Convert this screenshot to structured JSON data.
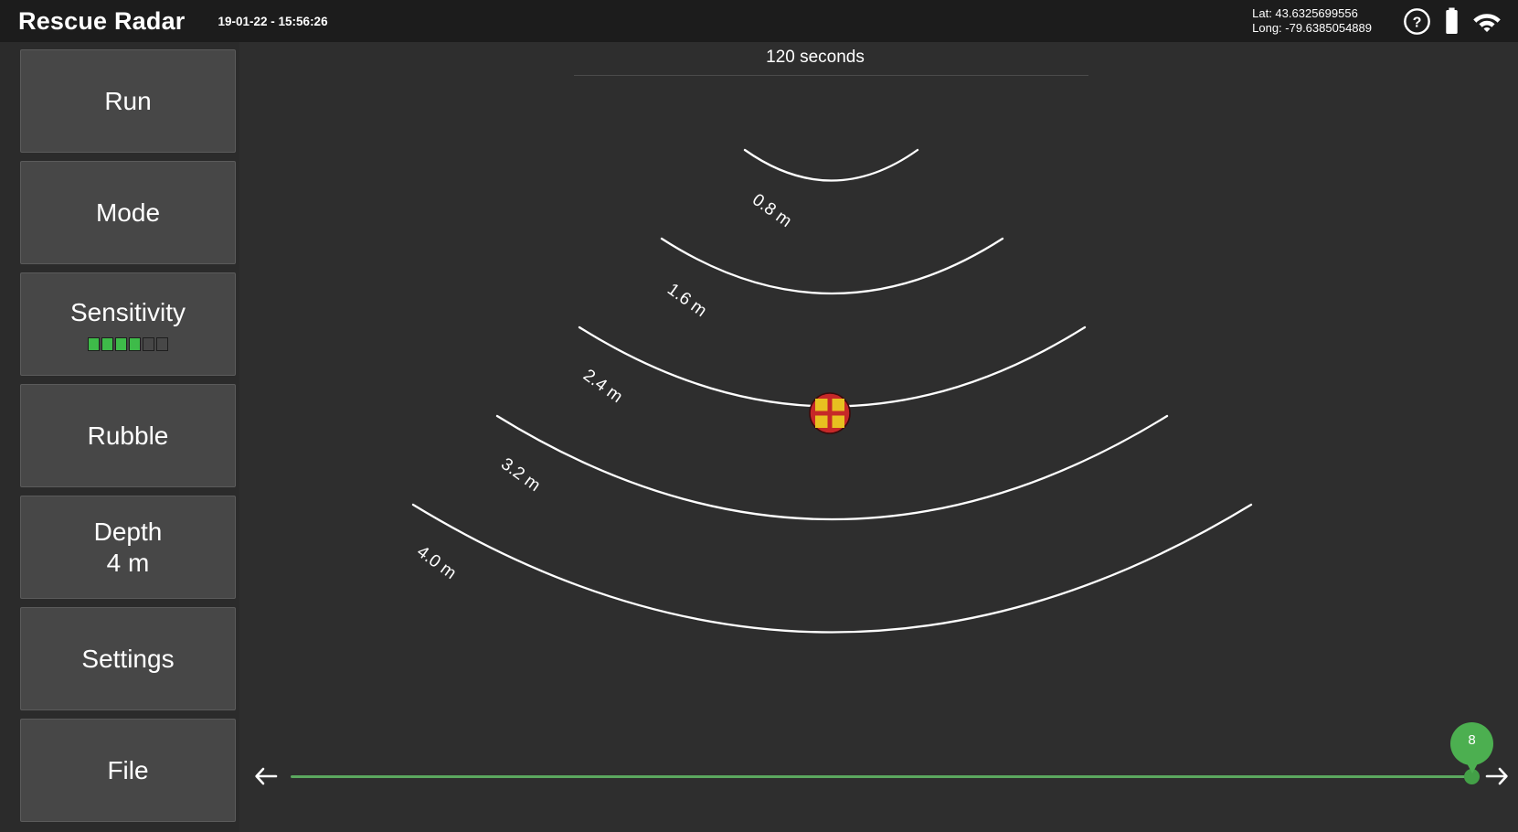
{
  "topbar": {
    "app_title": "Rescue Radar",
    "timestamp": "19-01-22 - 15:56:26",
    "gps": {
      "lat_line": "Lat: 43.6325699556",
      "long_line": "Long: -79.6385054889",
      "lat_value": "43.6325699556",
      "long_value": "-79.6385054889"
    },
    "icons": [
      "help-circle-icon",
      "battery-icon",
      "wifi-icon"
    ],
    "background_color": "#1c1c1c"
  },
  "sidebar": {
    "background_color": "#2b2b2b",
    "button_color": "#474747",
    "items": [
      {
        "id": "run",
        "label": "Run"
      },
      {
        "id": "mode",
        "label": "Mode"
      },
      {
        "id": "sensitivity",
        "label": "Sensitivity"
      },
      {
        "id": "rubble",
        "label": "Rubble"
      },
      {
        "id": "depth",
        "label": "Depth",
        "value": "4 m"
      },
      {
        "id": "settings",
        "label": "Settings"
      },
      {
        "id": "file",
        "label": "File"
      }
    ],
    "sensitivity_meter": {
      "total_segments": 6,
      "filled_segments": 4,
      "fill_color": "#3ebb49"
    }
  },
  "main": {
    "background_color": "#2e2e2e",
    "time_label": "120 seconds",
    "time_window_seconds": 120,
    "arc_color": "#ffffff",
    "depth_arcs": [
      {
        "label": "0.8 m",
        "depth_m": 0.8
      },
      {
        "label": "1.6 m",
        "depth_m": 1.6
      },
      {
        "label": "2.4 m",
        "depth_m": 2.4
      },
      {
        "label": "3.2 m",
        "depth_m": 3.2
      },
      {
        "label": "4.0 m",
        "depth_m": 4.0
      }
    ],
    "target": {
      "name": "detected-target",
      "outer_color": "#c62828",
      "inner_color": "#e8c020"
    }
  },
  "slider": {
    "value": "8",
    "track_color": "#5ba85f",
    "handle_color": "#43a047",
    "left_arrow": "arrow-left-icon",
    "right_arrow": "arrow-right-icon"
  }
}
